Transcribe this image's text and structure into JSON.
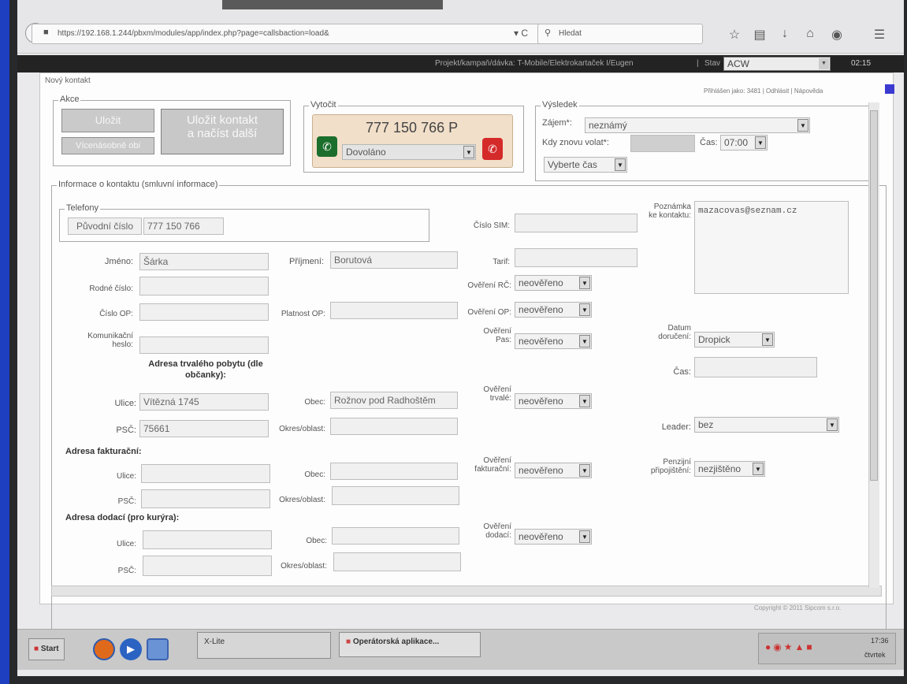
{
  "browser": {
    "url": "https://192.168.1.244/pbxm/modules/app/index.php?page=callsbaction=load&",
    "search_placeholder": "Hledat",
    "toolbar_icons": [
      "star-icon",
      "bookmarks-icon",
      "download-icon",
      "home-icon",
      "chat-icon",
      "menu-icon"
    ]
  },
  "app_nav": {
    "campaign": "Projekt/kampaň/dávka: T-Mobile/Elektrokartaček I/Eugen",
    "separator": "|",
    "status_label": "Stav",
    "status_value": "ACW",
    "timer": "02:15"
  },
  "window": {
    "title": "Nový kontakt",
    "login": "Přihlášen jako: 3481 | Odhlásit | Nápověda"
  },
  "akce": {
    "legend": "Akce",
    "save": "Uložit",
    "multi": "Vícenásobně obi",
    "save_next_line1": "Uložit kontakt",
    "save_next_line2": "a načíst další"
  },
  "dial": {
    "legend": "Vytočit",
    "number": "777 150 766 P",
    "status": "Dovoláno"
  },
  "result": {
    "legend": "Výsledek",
    "interest_label": "Zájem*:",
    "interest_value": "neznámý",
    "callback_label": "Kdy znovu volat*:",
    "time_label": "Čas:",
    "time_value": "07:00",
    "pick_time": "Vyberte čas"
  },
  "info": {
    "legend": "Informace o kontaktu (smluvní informace)",
    "phones_legend": "Telefony",
    "orig_number_label": "Původní číslo",
    "orig_number": "777 150 766",
    "name_label": "Jméno:",
    "name": "Šárka",
    "surname_label": "Příjmení:",
    "surname": "Borutová",
    "birth_label": "Rodné číslo:",
    "op_label": "Číslo OP:",
    "op_valid_label": "Platnost OP:",
    "comm_label_1": "Komunikační",
    "comm_label_2": "heslo:",
    "perm_heading_1": "Adresa trvalého pobytu (dle",
    "perm_heading_2": "občanky):",
    "street_label": "Ulice:",
    "street": "Vítězná 1745",
    "city_label": "Obec:",
    "city": "Rožnov pod Radhoštěm",
    "zip_label": "PSČ:",
    "zip": "75661",
    "district_label": "Okres/oblast:",
    "billing_heading": "Adresa fakturační:",
    "delivery_heading": "Adresa dodací (pro kurýra):",
    "sim_label": "Číslo SIM:",
    "tariff_label": "Tarif:",
    "verify_rc_label": "Ověření RČ:",
    "verify_op_label": "Ověření OP:",
    "verify_pas_label_1": "Ověření",
    "verify_pas_label_2": "Pas:",
    "verify_perm_label_2": "trvalé:",
    "verify_billing_label_2": "fakturační:",
    "verify_delivery_label_2": "dodací:",
    "unverified": "neověřeno",
    "note_label_1": "Poznámka",
    "note_label_2": "ke kontaktu:",
    "note": "mazacovas@seznam.cz",
    "delivery_date_label_1": "Datum",
    "delivery_date_label_2": "doručení:",
    "delivery_date_value": "Dropick",
    "time_label": "Čas:",
    "leader_label": "Leader:",
    "leader_value": "bez",
    "pension_label_1": "Penzijní",
    "pension_label_2": "připojištění:",
    "pension_value": "nezjištěno"
  },
  "footer": {
    "copyright": "Copyright © 2011 Sipcom s.r.o."
  },
  "taskbar": {
    "start": "Start",
    "item1": "X-Lite",
    "item2": "Operátorská aplikace...",
    "clock": "17:36",
    "day": "čtvrtek"
  }
}
